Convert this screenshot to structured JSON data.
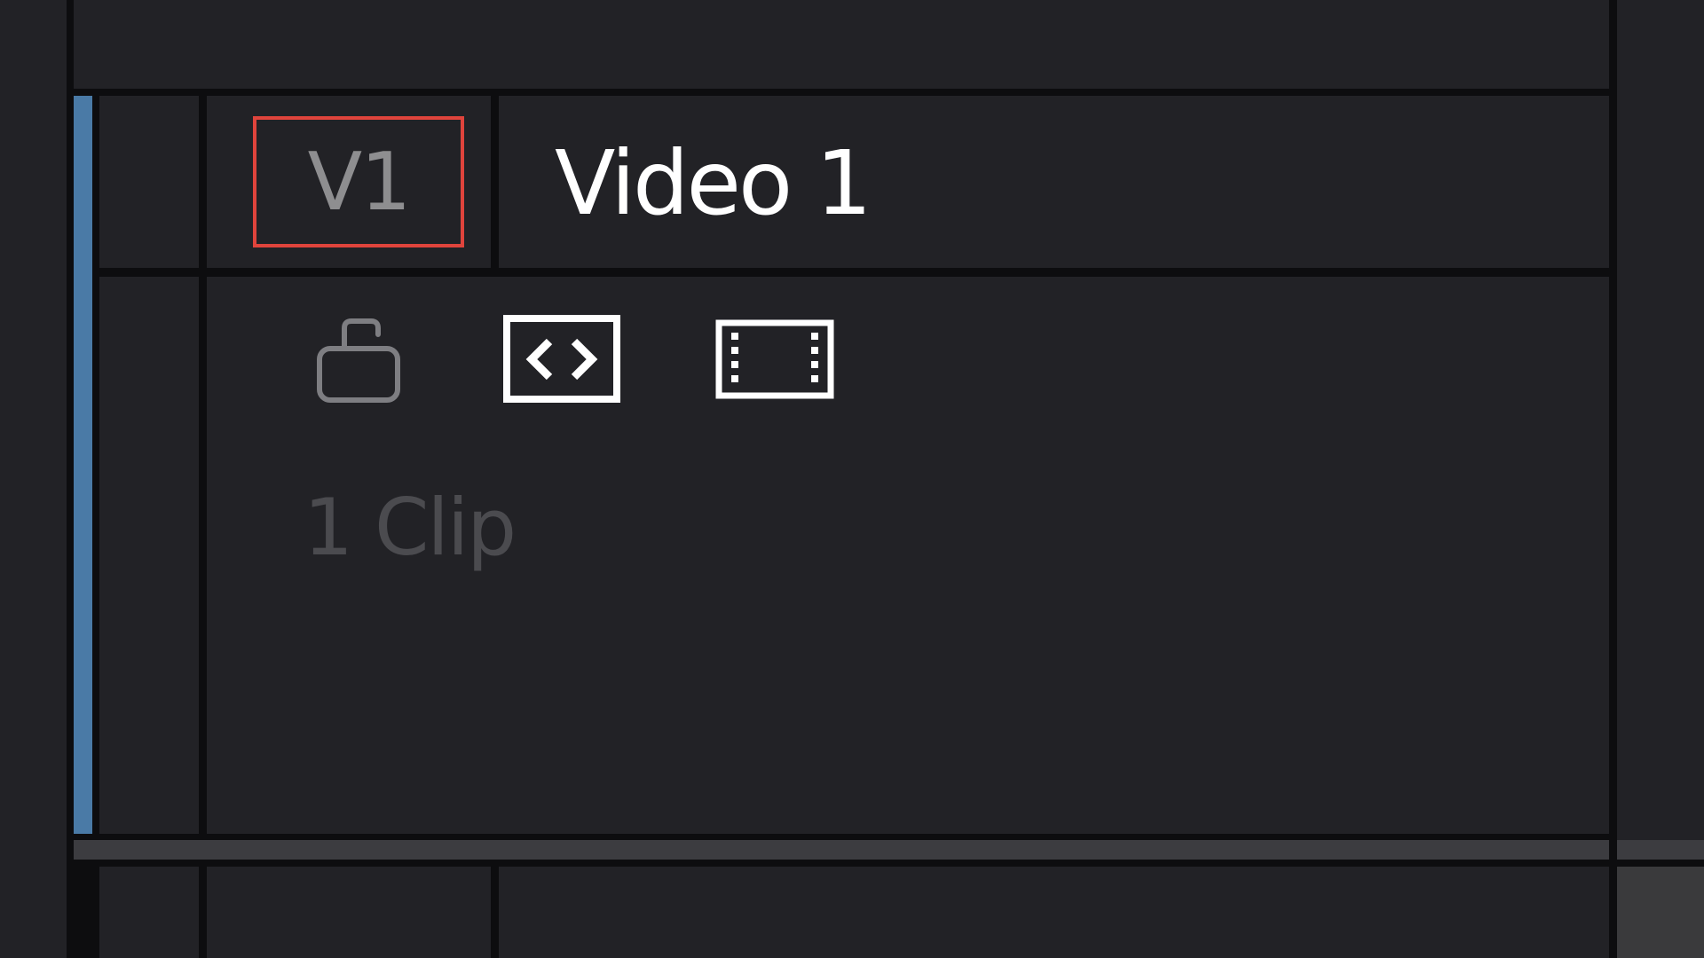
{
  "track": {
    "id_label": "V1",
    "name": "Video 1",
    "clip_count": "1 Clip",
    "color": "#4a7aa6",
    "controls": {
      "lock": {
        "icon": "unlock-icon",
        "state": "unlocked"
      },
      "auto_select": {
        "icon": "auto-select-icon",
        "state": "on"
      },
      "track_enable": {
        "icon": "film-strip-icon",
        "state": "on"
      }
    }
  },
  "colors": {
    "panel_bg": "#222226",
    "divider": "#0d0d0f",
    "track_id_highlight": "#e0443c",
    "scrollbar": "#3c3c40"
  }
}
